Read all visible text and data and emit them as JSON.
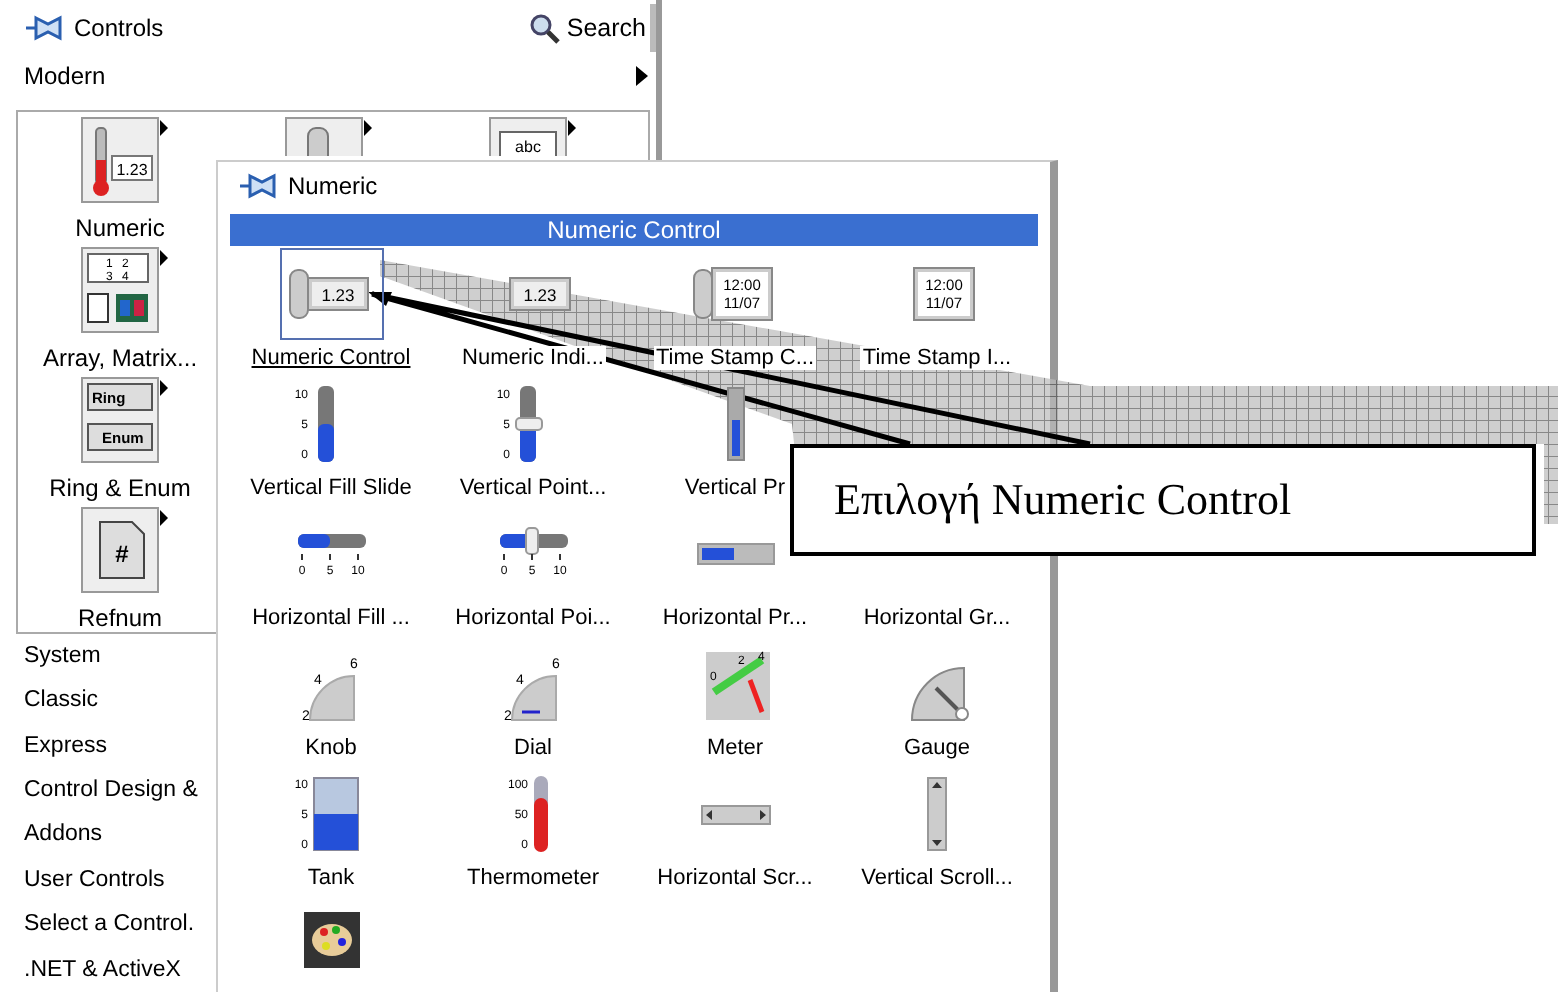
{
  "controls_palette": {
    "title": "Controls",
    "search": "Search",
    "category": "Modern",
    "tiles": [
      {
        "kind": "numeric",
        "label": "Numeric",
        "marks": [
          "1.23"
        ]
      },
      {
        "kind": "boolean"
      },
      {
        "kind": "string",
        "marks": [
          "abc"
        ]
      },
      {
        "kind": "array",
        "label": "Array, Matrix...",
        "marks": [
          "1",
          "2",
          "3",
          "4"
        ]
      },
      {
        "kind": "ring",
        "label": "Ring & Enum",
        "marks": [
          "Ring",
          "Enum"
        ]
      },
      {
        "kind": "refnum",
        "label": "Refnum",
        "marks": [
          "#"
        ]
      }
    ],
    "categories": [
      "System",
      "Classic",
      "Express",
      "Control Design &",
      "Addons",
      "User Controls",
      "Select a Control.",
      ".NET & ActiveX"
    ]
  },
  "numeric_palette": {
    "title": "Numeric",
    "selection_bar": "Numeric Control",
    "rows": [
      [
        {
          "kind": "numctl",
          "label": "Numeric Control",
          "selected": true,
          "marks": [
            "1.23"
          ]
        },
        {
          "kind": "numind",
          "label": "Numeric Indi...",
          "selected": false,
          "marks": [
            "1.23"
          ]
        },
        {
          "kind": "tsctl",
          "label": "Time Stamp C...",
          "selected": false,
          "marks": [
            "12:00",
            "11/07"
          ]
        },
        {
          "kind": "tsind",
          "label": "Time Stamp I...",
          "selected": false,
          "marks": [
            "12:00",
            "11/07"
          ]
        }
      ],
      [
        {
          "kind": "vslide",
          "label": "Vertical Fill Slide",
          "selected": false,
          "marks": [
            "10",
            "5",
            "0"
          ]
        },
        {
          "kind": "vpointer",
          "label": "Vertical Point...",
          "selected": false,
          "marks": [
            "10",
            "5",
            "0"
          ]
        },
        {
          "kind": "vprog",
          "label": "Vertical Pr",
          "selected": false
        }
      ],
      [
        {
          "kind": "hslide",
          "label": "Horizontal Fill ...",
          "selected": false,
          "marks": [
            "0",
            "5",
            "10"
          ]
        },
        {
          "kind": "hpointer",
          "label": "Horizontal Poi...",
          "selected": false,
          "marks": [
            "0",
            "5",
            "10"
          ]
        },
        {
          "kind": "hprog",
          "label": "Horizontal Pr...",
          "selected": false
        },
        {
          "label": "Horizontal Gr...",
          "selected": false
        }
      ],
      [
        {
          "kind": "knob",
          "label": "Knob",
          "selected": false,
          "marks": [
            "2",
            "4",
            "6"
          ]
        },
        {
          "kind": "dial",
          "label": "Dial",
          "selected": false,
          "marks": [
            "2",
            "4",
            "6"
          ]
        },
        {
          "kind": "meter",
          "label": "Meter",
          "selected": false,
          "marks": [
            "0",
            "2",
            "4"
          ]
        },
        {
          "kind": "gauge",
          "label": "Gauge",
          "selected": false
        }
      ],
      [
        {
          "kind": "tank",
          "label": "Tank",
          "selected": false,
          "marks": [
            "10",
            "5",
            "0"
          ]
        },
        {
          "kind": "thermo",
          "label": "Thermometer",
          "selected": false,
          "marks": [
            "100",
            "50",
            "0"
          ]
        },
        {
          "kind": "hscroll",
          "label": "Horizontal Scr...",
          "selected": false
        },
        {
          "kind": "vscroll",
          "label": "Vertical Scroll...",
          "selected": false
        }
      ],
      [
        {
          "kind": "palette",
          "selected": false
        }
      ]
    ]
  },
  "callout": {
    "text": "Επιλογή Numeric Control"
  }
}
